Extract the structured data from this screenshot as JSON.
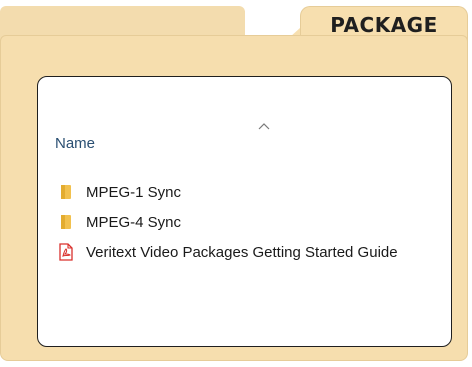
{
  "folder": {
    "tab_label": "PACKAGE",
    "colors": {
      "folder_fill": "#f6deae",
      "folder_edge": "#e6cc98",
      "folder_icon": "#f2c14e",
      "pdf_red": "#d9302c"
    }
  },
  "explorer": {
    "column_header": "Name",
    "sort_indicator_icon": "chevron-up-icon",
    "items": [
      {
        "label": "MPEG-1 Sync",
        "icon": "folder-icon"
      },
      {
        "label": "MPEG-4 Sync",
        "icon": "folder-icon"
      },
      {
        "label": "Veritext Video Packages Getting Started Guide",
        "icon": "pdf-file-icon"
      }
    ]
  }
}
